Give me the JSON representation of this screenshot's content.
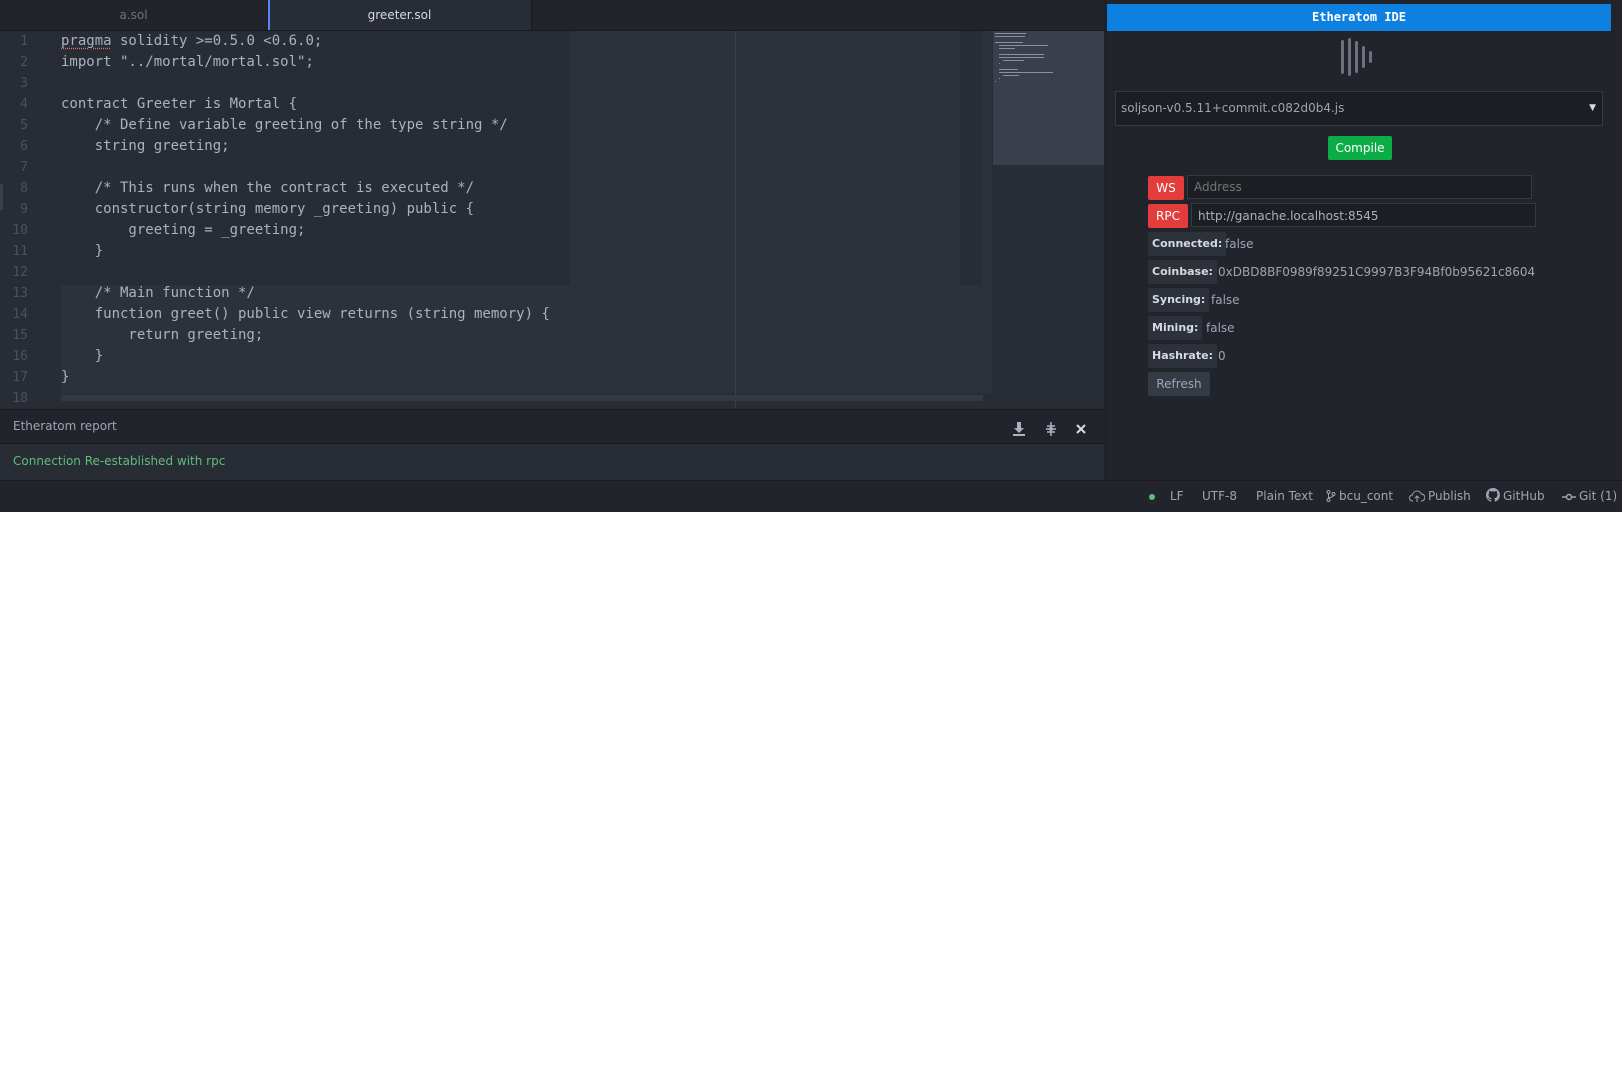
{
  "tabs": [
    {
      "label": "a.sol",
      "active": false
    },
    {
      "label": "greeter.sol",
      "active": true
    }
  ],
  "editor": {
    "line_numbers": [
      "1",
      "2",
      "3",
      "4",
      "5",
      "6",
      "7",
      "8",
      "9",
      "10",
      "11",
      "12",
      "13",
      "14",
      "15",
      "16",
      "17",
      "18"
    ],
    "lines": [
      {
        "pre": "",
        "squiggle": "pragma",
        "rest": " solidity >=0.5.0 <0.6.0;"
      },
      {
        "pre": "import \"../mortal/mortal.sol\";"
      },
      {
        "pre": ""
      },
      {
        "pre": "contract Greeter is Mortal {"
      },
      {
        "pre": "    /* Define variable greeting of the type string */"
      },
      {
        "pre": "    string greeting;"
      },
      {
        "pre": ""
      },
      {
        "pre": "    /* This runs when the contract is executed */"
      },
      {
        "pre": "    constructor(string memory _greeting) public {"
      },
      {
        "pre": "        greeting = _greeting;"
      },
      {
        "pre": "    }"
      },
      {
        "pre": ""
      },
      {
        "pre": "    /* Main function */"
      },
      {
        "pre": "    function greet() public view returns (string memory) {"
      },
      {
        "pre": "        return greeting;"
      },
      {
        "pre": "    }"
      },
      {
        "pre": "}"
      },
      {
        "pre": ""
      }
    ]
  },
  "report": {
    "title": "Etheratom report",
    "message": "Connection Re-established with rpc",
    "icons": [
      "download-icon",
      "pin-icon",
      "close-icon"
    ]
  },
  "ide": {
    "title": "Etheratom IDE",
    "compiler_version": "soljson-v0.5.11+commit.c082d0b4.js",
    "compile_label": "Compile",
    "ws_label": "WS",
    "ws_placeholder": "Address",
    "rpc_label": "RPC",
    "rpc_value": "http://ganache.localhost:8545",
    "status": {
      "connected_label": "Connected:",
      "connected": "false",
      "coinbase_label": "Coinbase:",
      "coinbase": "0xDBD8BF0989f89251C9997B3F94Bf0b95621c8604",
      "syncing_label": "Syncing:",
      "syncing": "false",
      "mining_label": "Mining:",
      "mining": "false",
      "hashrate_label": "Hashrate:",
      "hashrate": "0"
    },
    "refresh_label": "Refresh"
  },
  "statusbar": {
    "line_ending": "LF",
    "encoding": "UTF-8",
    "grammar": "Plain Text",
    "branch": "bcu_cont",
    "publish": "Publish",
    "github": "GitHub",
    "git": "Git (1)"
  },
  "colors": {
    "accent": "#0d80e0",
    "compile": "#0cad47",
    "danger": "#e23c3c",
    "success_text": "#5fbd7a"
  }
}
